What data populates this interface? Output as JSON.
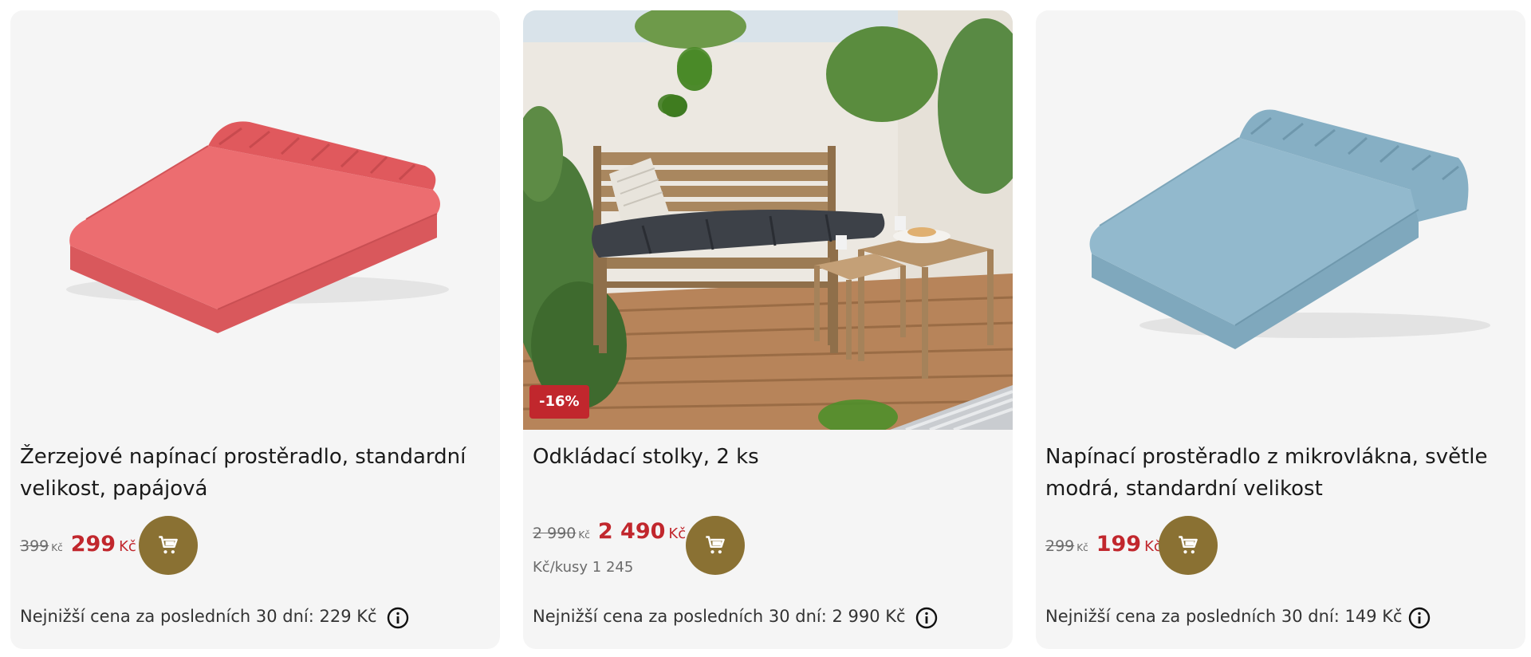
{
  "products": [
    {
      "title": "Žerzejové napínací prostěradlo, standardní velikost, papájová",
      "old_price": "399",
      "old_currency": "Kč",
      "new_price": "299",
      "new_currency": "Kč",
      "lowest_price_note": "Nejnižší cena za posledních 30 dní: 229 Kč",
      "image_icon": "coral-fitted-sheet-image"
    },
    {
      "badge": "-16%",
      "title": "Odkládací stolky, 2 ks",
      "old_price": "2 990",
      "old_currency": "Kč",
      "new_price": "2 490",
      "new_currency": "Kč",
      "unit_price": "Kč/kusy 1 245",
      "lowest_price_note": "Nejnižší cena za posledních 30 dní: 2 990 Kč",
      "image_icon": "garden-bench-side-tables-image"
    },
    {
      "title": "Napínací prostěradlo z mikrovlákna, světle modrá, standardní velikost",
      "old_price": "299",
      "old_currency": "Kč",
      "new_price": "199",
      "new_currency": "Kč",
      "lowest_price_note": "Nejnižší cena za posledních 30 dní: 149 Kč",
      "image_icon": "light-blue-fitted-sheet-image"
    }
  ],
  "colors": {
    "card_bg": "#f5f5f5",
    "sale_red": "#c1272d",
    "cart_button": "#8a7133",
    "muted_text": "#6b6b6b"
  },
  "icons": {
    "cart": "cart-icon",
    "info": "info-icon"
  }
}
